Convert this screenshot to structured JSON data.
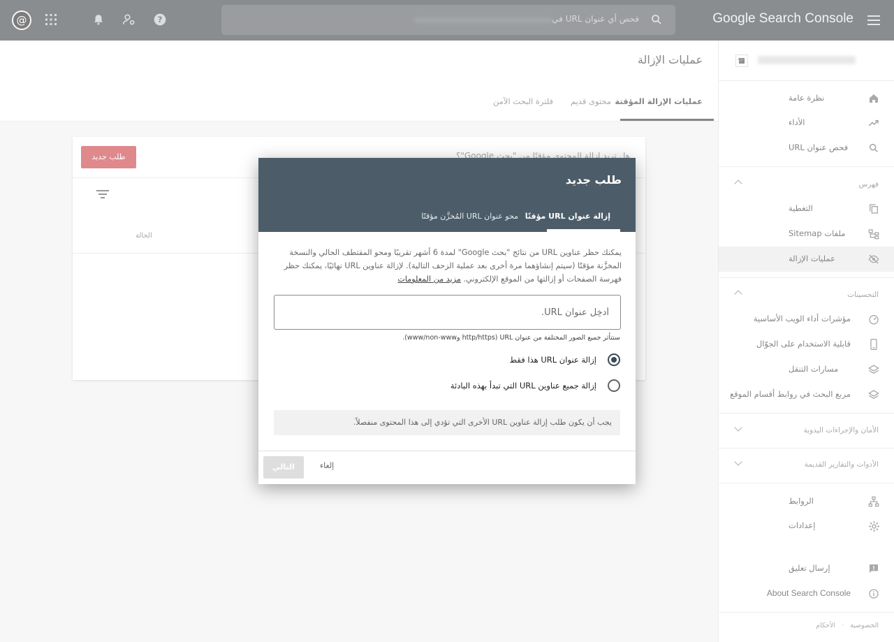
{
  "topbar": {
    "brand": "Google Search Console",
    "search_placeholder": "فحص أي عنوان URL في",
    "avatar_char": "@"
  },
  "sidebar": {
    "items_top": [
      {
        "label": "نظرة عامة",
        "icon": "home-icon"
      },
      {
        "label": "الأداء",
        "icon": "trending-up-icon"
      },
      {
        "label": "فحص عنوان URL",
        "icon": "search-icon"
      }
    ],
    "index_section": "فهرس",
    "items_index": [
      {
        "label": "التغطية",
        "icon": "copy-icon"
      },
      {
        "label": "ملفات Sitemap",
        "icon": "sitemap-icon"
      },
      {
        "label": "عمليات الإزالة",
        "icon": "eye-off-icon",
        "active": true
      }
    ],
    "enh_section": "التحسينات",
    "items_enh": [
      {
        "label": "مؤشرات أداء الويب الأساسية",
        "icon": "speedometer-icon"
      },
      {
        "label": "قابلية الاستخدام على الجوّال",
        "icon": "phone-icon"
      },
      {
        "label": "مسارات التنقل",
        "icon": "layers-icon"
      },
      {
        "label": "مربع البحث في روابط أقسام الموقع",
        "icon": "layers-icon"
      }
    ],
    "security_section": "الأمان والإجراءات اليدوية",
    "legacy_section": "الأدوات والتقارير القديمة",
    "items_bottom": [
      {
        "label": "الروابط",
        "icon": "links-icon"
      },
      {
        "label": "إعدادات",
        "icon": "gear-icon"
      }
    ],
    "feedback": "إرسال تعليق",
    "about": "About Search Console",
    "privacy": "الخصوصية",
    "terms": "الأحكام"
  },
  "main": {
    "page_title": "عمليات الإزالة",
    "tabs": [
      "عمليات الإزالة المؤقتة",
      "محتوى قديم",
      "فلترة البحث الآمن"
    ],
    "card_question": "هل تريد إزالة المحتوى مؤقتًا من \"بحث Google\"؟",
    "new_request": "طلب جديد",
    "col_status": "الحالة"
  },
  "dialog": {
    "title": "طلب جديد",
    "tabs": [
      "إزالة عنوان URL مؤقتًا",
      "محو عنوان URL المُخزَّن مؤقتًا"
    ],
    "description": "يمكنك حظر عناوين URL من نتائج \"بحث Google\" لمدة 6 أشهر تقريبًا ومحو المقتطف الحالي والنسخة المخزَّنة مؤقتًا (سيتم إنشاؤهما مرة أخرى بعد عملية الزحف التالية). لإزالة عناوين URL نهائيًا، يمكنك حظر فهرسة الصفحات أو إزالتها من الموقع الإلكتروني.",
    "learn_more": "مزيد من المعلومات",
    "input_placeholder": "أدخِل عنوان URL.",
    "hint": "ستتأثر جميع الصور المختلفة من عنوان URL (http/https وwww/non-www).",
    "radio_options": [
      "إزالة عنوان URL هذا فقط",
      "إزالة جميع عناوين URL التي تبدأ بهذه البادئة"
    ],
    "notice": "يجب أن يكون طلب إزالة عناوين URL الأخرى التي تؤدي إلى هذا المحتوى منفصلاً.",
    "next": "التالي",
    "cancel": "إلغاء"
  },
  "colors": {
    "topbar": "#2b3033",
    "dialog_header": "#4c5d69",
    "primary_button": "#c5282f"
  }
}
